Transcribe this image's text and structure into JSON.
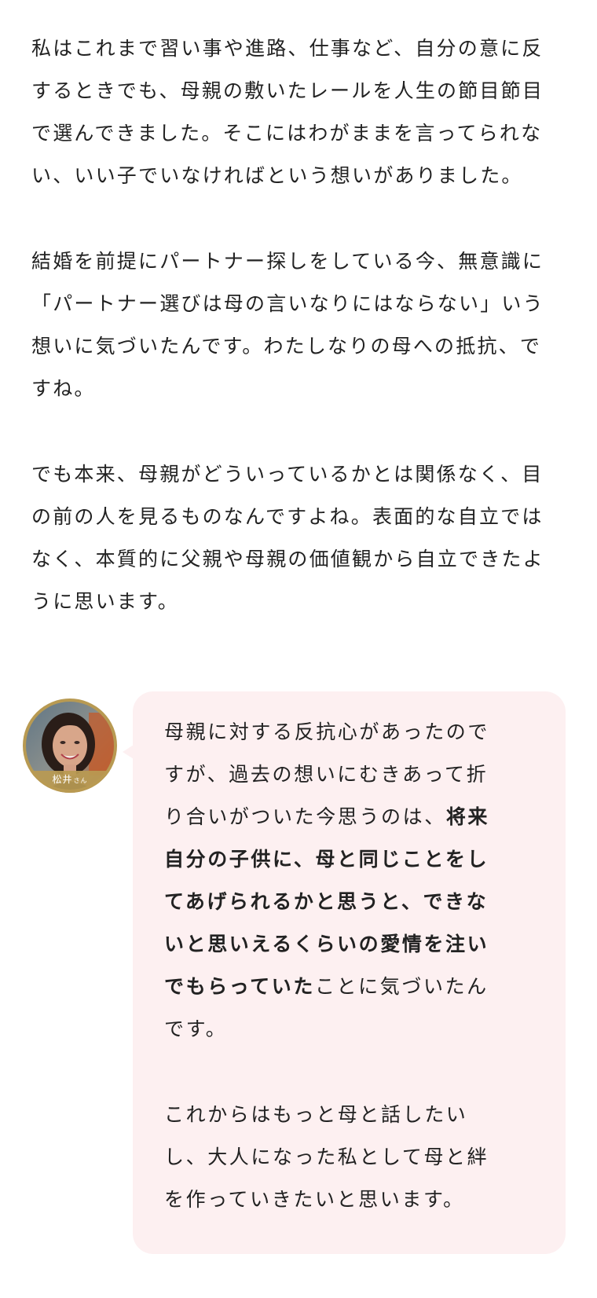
{
  "paragraphs": [
    {
      "lines": [
        "私はこれまで習い事や進路、仕事など、自分の意に反",
        "するときでも、母親の敷いたレールを人生の節目節目",
        "で選んできました。そこにはわがままを言ってられな",
        "い、いい子でいなければという想いがありました。"
      ]
    },
    {
      "lines": [
        "結婚を前提にパートナー探しをしている今、無意識に",
        "「パートナー選びは母の言いなりにはならない」いう",
        "想いに気づいたんです。わたしなりの母への抵抗、で",
        "すね。"
      ]
    },
    {
      "lines": [
        "でも本来、母親がどういっているかとは関係なく、目",
        "の前の人を見るものなんですよね。表面的な自立では",
        "なく、本質的に父親や母親の価値観から自立できたよ",
        "うに思います。"
      ]
    }
  ],
  "speaker": {
    "name": "松井",
    "honorific": "さん",
    "colors": {
      "ring": "#b89a52",
      "bubble": "#fdf0f1"
    }
  },
  "quote": {
    "paragraph1": {
      "line1": "母親に対する反抗心があったので",
      "line2": "すが、過去の想いにむきあって折",
      "line3_plain": "り合いがついた今思うのは、",
      "line3_bold": "将来",
      "line4_bold": "自分の子供に、母と同じことをし",
      "line5_bold": "てあげられるかと思うと、できな",
      "line6_bold": "いと思いえるくらいの愛情を注い",
      "line7_bold": "でもらっていた",
      "line7_plain": "ことに気づいたん",
      "line8": "です。"
    },
    "paragraph2": {
      "lines": [
        "これからはもっと母と話したい",
        "し、大人になった私として母と絆",
        "を作っていきたいと思います。"
      ]
    }
  }
}
